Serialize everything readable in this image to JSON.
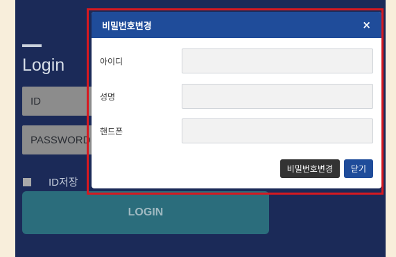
{
  "login": {
    "title": "Login",
    "id_placeholder": "ID",
    "password_placeholder": "PASSWORD",
    "save_id_label": "ID저장",
    "login_button": "LOGIN"
  },
  "modal": {
    "title": "비밀번호변경",
    "close_glyph": "×",
    "fields": [
      {
        "label": "아이디",
        "value": ""
      },
      {
        "label": "성명",
        "value": ""
      },
      {
        "label": "핸드폰",
        "value": ""
      }
    ],
    "change_button": "비밀번호변경",
    "close_button": "닫기"
  },
  "colors": {
    "page_background": "#f8eedb",
    "login_background": "#1b2a58",
    "modal_header": "#1f4c9a",
    "highlight_border": "#d71920",
    "login_button": "#2b6d7c"
  }
}
